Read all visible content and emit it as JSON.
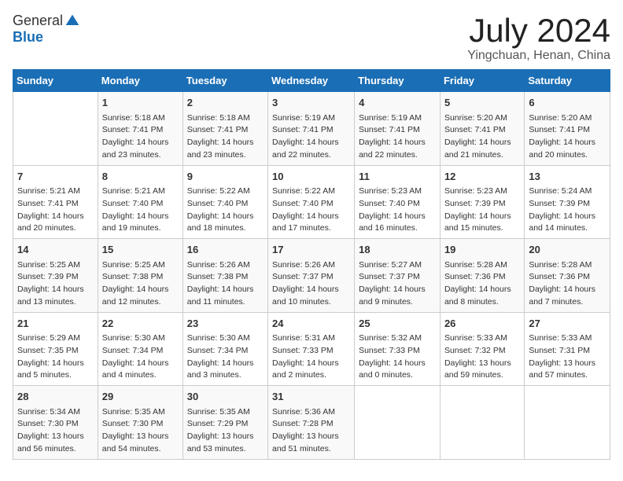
{
  "header": {
    "logo_general": "General",
    "logo_blue": "Blue",
    "month_title": "July 2024",
    "location": "Yingchuan, Henan, China"
  },
  "columns": [
    "Sunday",
    "Monday",
    "Tuesday",
    "Wednesday",
    "Thursday",
    "Friday",
    "Saturday"
  ],
  "weeks": [
    [
      {
        "day": "",
        "content": ""
      },
      {
        "day": "1",
        "content": "Sunrise: 5:18 AM\nSunset: 7:41 PM\nDaylight: 14 hours\nand 23 minutes."
      },
      {
        "day": "2",
        "content": "Sunrise: 5:18 AM\nSunset: 7:41 PM\nDaylight: 14 hours\nand 23 minutes."
      },
      {
        "day": "3",
        "content": "Sunrise: 5:19 AM\nSunset: 7:41 PM\nDaylight: 14 hours\nand 22 minutes."
      },
      {
        "day": "4",
        "content": "Sunrise: 5:19 AM\nSunset: 7:41 PM\nDaylight: 14 hours\nand 22 minutes."
      },
      {
        "day": "5",
        "content": "Sunrise: 5:20 AM\nSunset: 7:41 PM\nDaylight: 14 hours\nand 21 minutes."
      },
      {
        "day": "6",
        "content": "Sunrise: 5:20 AM\nSunset: 7:41 PM\nDaylight: 14 hours\nand 20 minutes."
      }
    ],
    [
      {
        "day": "7",
        "content": "Sunrise: 5:21 AM\nSunset: 7:41 PM\nDaylight: 14 hours\nand 20 minutes."
      },
      {
        "day": "8",
        "content": "Sunrise: 5:21 AM\nSunset: 7:40 PM\nDaylight: 14 hours\nand 19 minutes."
      },
      {
        "day": "9",
        "content": "Sunrise: 5:22 AM\nSunset: 7:40 PM\nDaylight: 14 hours\nand 18 minutes."
      },
      {
        "day": "10",
        "content": "Sunrise: 5:22 AM\nSunset: 7:40 PM\nDaylight: 14 hours\nand 17 minutes."
      },
      {
        "day": "11",
        "content": "Sunrise: 5:23 AM\nSunset: 7:40 PM\nDaylight: 14 hours\nand 16 minutes."
      },
      {
        "day": "12",
        "content": "Sunrise: 5:23 AM\nSunset: 7:39 PM\nDaylight: 14 hours\nand 15 minutes."
      },
      {
        "day": "13",
        "content": "Sunrise: 5:24 AM\nSunset: 7:39 PM\nDaylight: 14 hours\nand 14 minutes."
      }
    ],
    [
      {
        "day": "14",
        "content": "Sunrise: 5:25 AM\nSunset: 7:39 PM\nDaylight: 14 hours\nand 13 minutes."
      },
      {
        "day": "15",
        "content": "Sunrise: 5:25 AM\nSunset: 7:38 PM\nDaylight: 14 hours\nand 12 minutes."
      },
      {
        "day": "16",
        "content": "Sunrise: 5:26 AM\nSunset: 7:38 PM\nDaylight: 14 hours\nand 11 minutes."
      },
      {
        "day": "17",
        "content": "Sunrise: 5:26 AM\nSunset: 7:37 PM\nDaylight: 14 hours\nand 10 minutes."
      },
      {
        "day": "18",
        "content": "Sunrise: 5:27 AM\nSunset: 7:37 PM\nDaylight: 14 hours\nand 9 minutes."
      },
      {
        "day": "19",
        "content": "Sunrise: 5:28 AM\nSunset: 7:36 PM\nDaylight: 14 hours\nand 8 minutes."
      },
      {
        "day": "20",
        "content": "Sunrise: 5:28 AM\nSunset: 7:36 PM\nDaylight: 14 hours\nand 7 minutes."
      }
    ],
    [
      {
        "day": "21",
        "content": "Sunrise: 5:29 AM\nSunset: 7:35 PM\nDaylight: 14 hours\nand 5 minutes."
      },
      {
        "day": "22",
        "content": "Sunrise: 5:30 AM\nSunset: 7:34 PM\nDaylight: 14 hours\nand 4 minutes."
      },
      {
        "day": "23",
        "content": "Sunrise: 5:30 AM\nSunset: 7:34 PM\nDaylight: 14 hours\nand 3 minutes."
      },
      {
        "day": "24",
        "content": "Sunrise: 5:31 AM\nSunset: 7:33 PM\nDaylight: 14 hours\nand 2 minutes."
      },
      {
        "day": "25",
        "content": "Sunrise: 5:32 AM\nSunset: 7:33 PM\nDaylight: 14 hours\nand 0 minutes."
      },
      {
        "day": "26",
        "content": "Sunrise: 5:33 AM\nSunset: 7:32 PM\nDaylight: 13 hours\nand 59 minutes."
      },
      {
        "day": "27",
        "content": "Sunrise: 5:33 AM\nSunset: 7:31 PM\nDaylight: 13 hours\nand 57 minutes."
      }
    ],
    [
      {
        "day": "28",
        "content": "Sunrise: 5:34 AM\nSunset: 7:30 PM\nDaylight: 13 hours\nand 56 minutes."
      },
      {
        "day": "29",
        "content": "Sunrise: 5:35 AM\nSunset: 7:30 PM\nDaylight: 13 hours\nand 54 minutes."
      },
      {
        "day": "30",
        "content": "Sunrise: 5:35 AM\nSunset: 7:29 PM\nDaylight: 13 hours\nand 53 minutes."
      },
      {
        "day": "31",
        "content": "Sunrise: 5:36 AM\nSunset: 7:28 PM\nDaylight: 13 hours\nand 51 minutes."
      },
      {
        "day": "",
        "content": ""
      },
      {
        "day": "",
        "content": ""
      },
      {
        "day": "",
        "content": ""
      }
    ]
  ]
}
